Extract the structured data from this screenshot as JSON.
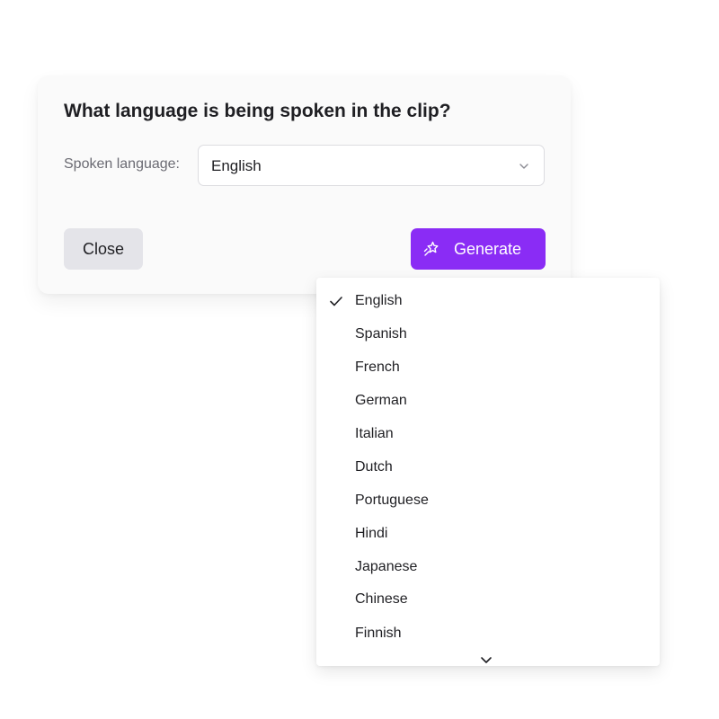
{
  "dialog": {
    "title": "What language is being spoken in the clip?",
    "field_label": "Spoken language:",
    "selected_language": "English",
    "close_label": "Close",
    "generate_label": "Generate",
    "accent_color": "#8a2cf5"
  },
  "dropdown": {
    "options": [
      {
        "label": "English",
        "selected": true
      },
      {
        "label": "Spanish",
        "selected": false
      },
      {
        "label": "French",
        "selected": false
      },
      {
        "label": "German",
        "selected": false
      },
      {
        "label": "Italian",
        "selected": false
      },
      {
        "label": "Dutch",
        "selected": false
      },
      {
        "label": "Portuguese",
        "selected": false
      },
      {
        "label": "Hindi",
        "selected": false
      },
      {
        "label": "Japanese",
        "selected": false
      },
      {
        "label": "Chinese",
        "selected": false
      },
      {
        "label": "Finnish",
        "selected": false
      }
    ],
    "icons": {
      "check": "check-icon",
      "scroll_more": "chevron-down-icon",
      "select_chevron": "chevron-down-icon",
      "generate": "sparkle-icon"
    }
  }
}
